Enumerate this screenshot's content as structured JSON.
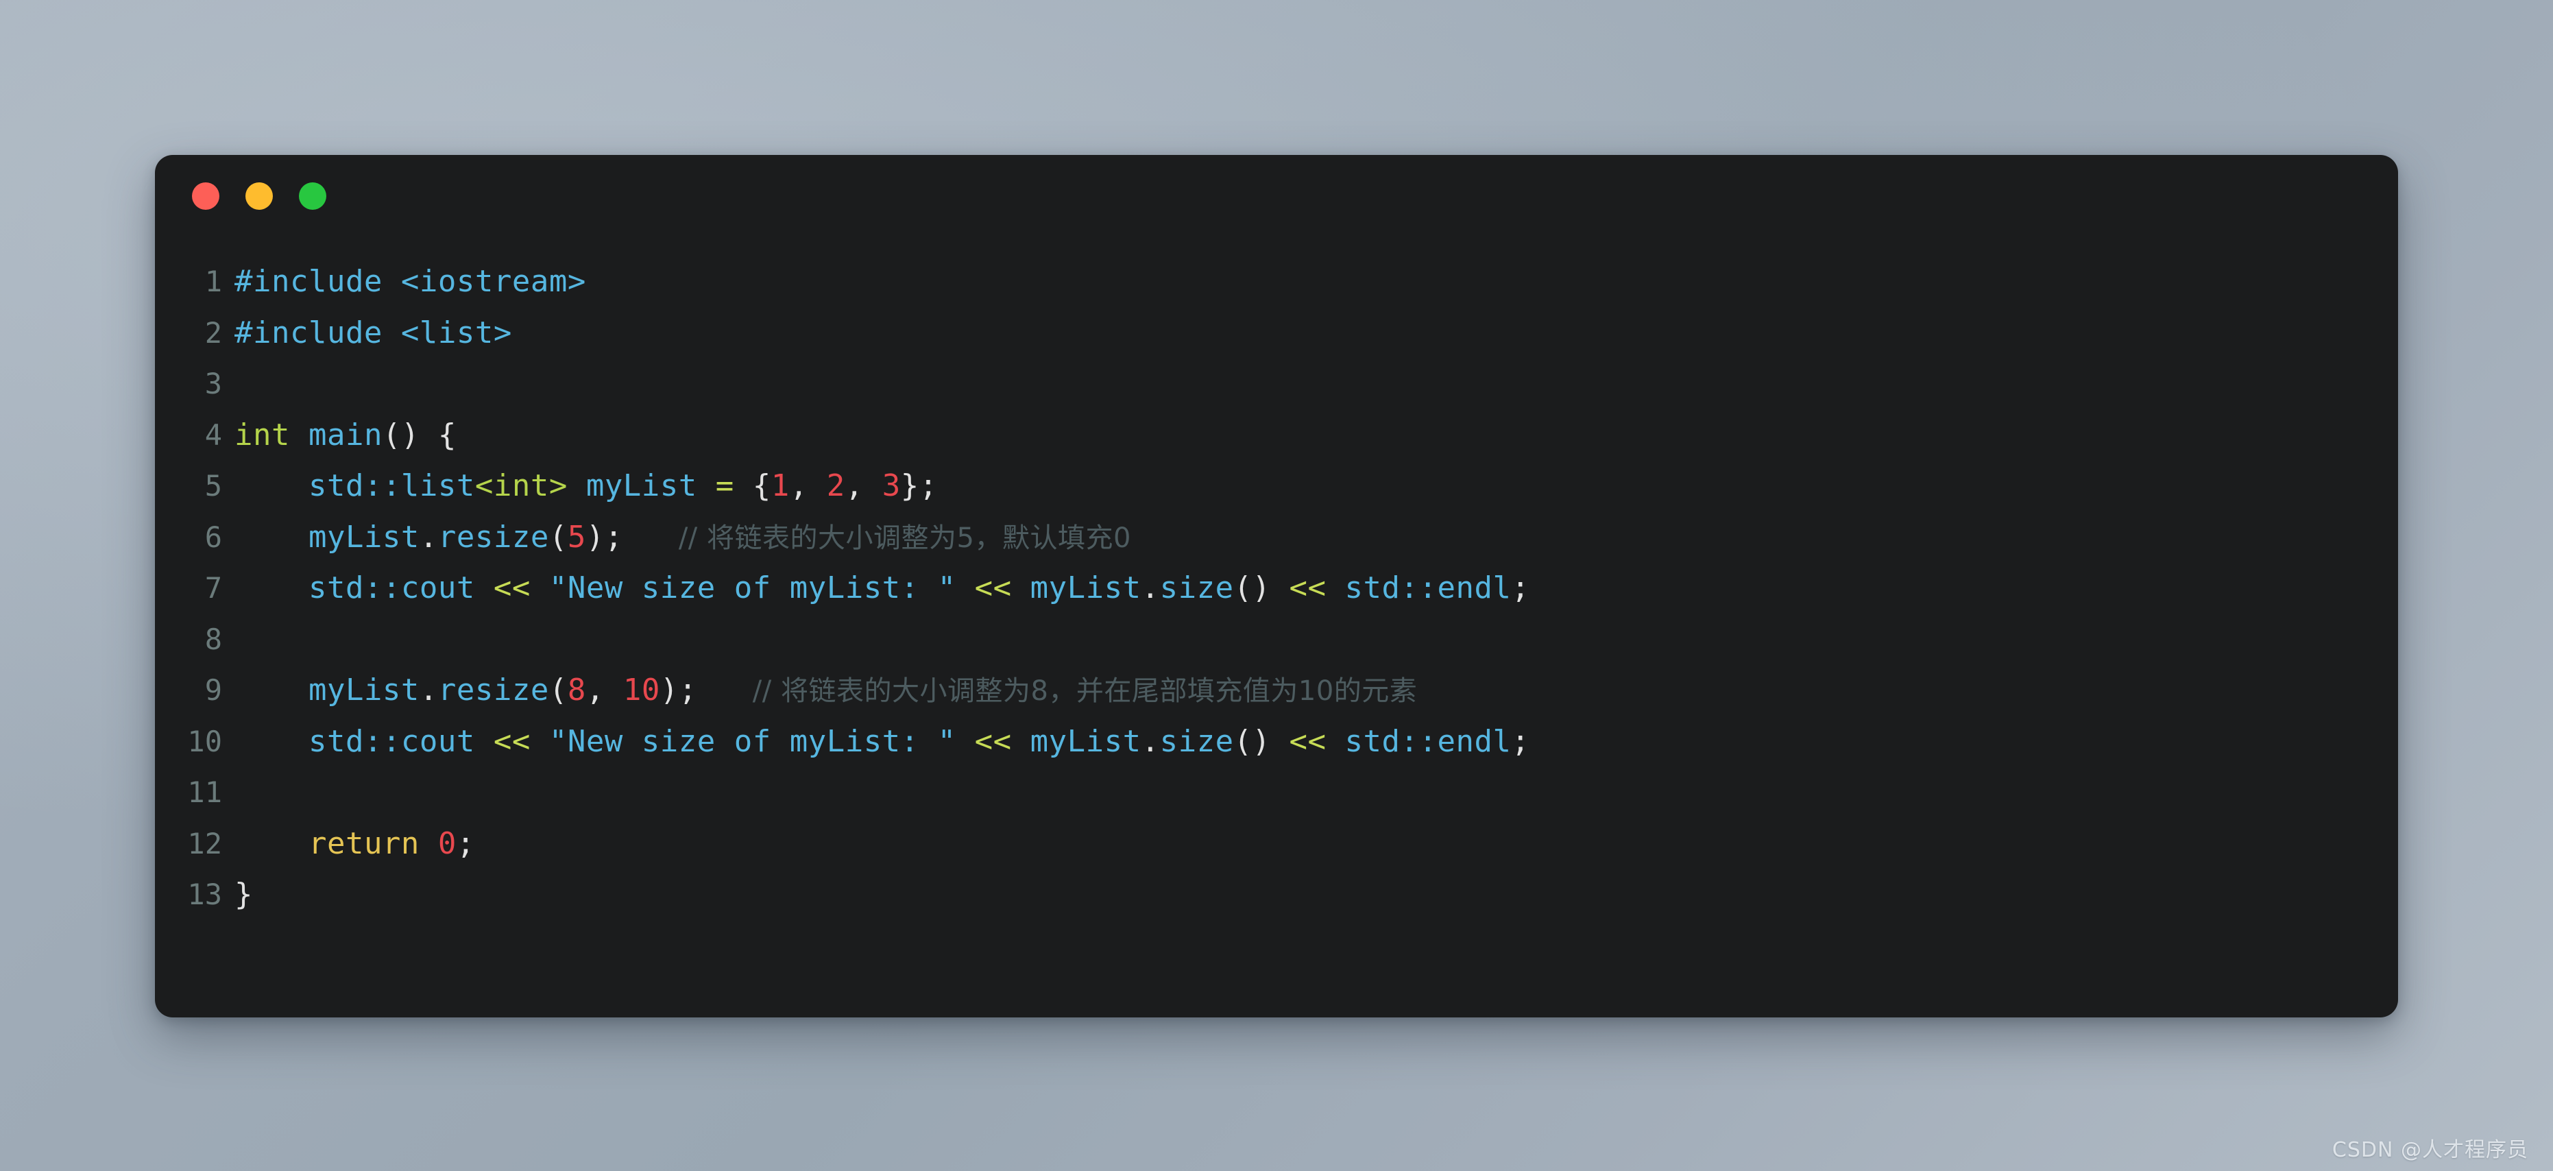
{
  "window": {
    "background_color": "#1b1c1d",
    "traffic_lights": [
      {
        "name": "close",
        "color": "#fd5f57"
      },
      {
        "name": "minimize",
        "color": "#febc2e"
      },
      {
        "name": "maximize",
        "color": "#28c740"
      }
    ]
  },
  "theme": {
    "page_background_start": "#a7b2bd",
    "page_background_end": "#b2bcc6",
    "line_number_color": "#6b7b7b",
    "identifier_color": "#56b6e0",
    "type_color": "#b5d44b",
    "operator_color": "#c7dc56",
    "number_color": "#e8484e",
    "keyword_color": "#e5c454",
    "punctuation_color": "#e2e2e2",
    "comment_color": "#4d5c60"
  },
  "watermark": {
    "text": "CSDN @人才程序员"
  },
  "code": {
    "language": "C++",
    "lines": [
      {
        "number": "1",
        "text": "#include <iostream>",
        "tokens": [
          {
            "t": "#include <iostream>",
            "c": "t-pre"
          }
        ]
      },
      {
        "number": "2",
        "text": "#include <list>",
        "tokens": [
          {
            "t": "#include <list>",
            "c": "t-pre"
          }
        ]
      },
      {
        "number": "3",
        "text": "",
        "tokens": []
      },
      {
        "number": "4",
        "text": "int main() {",
        "tokens": [
          {
            "t": "int",
            "c": "t-type"
          },
          {
            "t": " ",
            "c": "t-punc"
          },
          {
            "t": "main",
            "c": "t-ident"
          },
          {
            "t": "() {",
            "c": "t-punc"
          }
        ]
      },
      {
        "number": "5",
        "text": "    std::list<int> myList = {1, 2, 3};",
        "tokens": [
          {
            "t": "    std::list",
            "c": "t-ident"
          },
          {
            "t": "<int>",
            "c": "t-type"
          },
          {
            "t": " ",
            "c": "t-punc"
          },
          {
            "t": "myList",
            "c": "t-ident"
          },
          {
            "t": " ",
            "c": "t-punc"
          },
          {
            "t": "=",
            "c": "t-op"
          },
          {
            "t": " {",
            "c": "t-punc"
          },
          {
            "t": "1",
            "c": "t-num"
          },
          {
            "t": ", ",
            "c": "t-punc"
          },
          {
            "t": "2",
            "c": "t-num"
          },
          {
            "t": ", ",
            "c": "t-punc"
          },
          {
            "t": "3",
            "c": "t-num"
          },
          {
            "t": "};",
            "c": "t-punc"
          }
        ]
      },
      {
        "number": "6",
        "text": "    myList.resize(5);  // 将链表的大小调整为5，默认填充0",
        "tokens": [
          {
            "t": "    myList",
            "c": "t-ident"
          },
          {
            "t": ".",
            "c": "t-punc"
          },
          {
            "t": "resize",
            "c": "t-ident"
          },
          {
            "t": "(",
            "c": "t-punc"
          },
          {
            "t": "5",
            "c": "t-num"
          },
          {
            "t": ");",
            "c": "t-punc"
          },
          {
            "t": "   ",
            "c": "t-punc"
          },
          {
            "t": "// 将链表的大小调整为5，默认填充0",
            "c": "t-cmt"
          }
        ]
      },
      {
        "number": "7",
        "text": "    std::cout << \"New size of myList: \" << myList.size() << std::endl;",
        "tokens": [
          {
            "t": "    std::cout",
            "c": "t-ident"
          },
          {
            "t": " ",
            "c": "t-punc"
          },
          {
            "t": "<<",
            "c": "t-op"
          },
          {
            "t": " ",
            "c": "t-punc"
          },
          {
            "t": "\"New size of myList: \"",
            "c": "t-ident"
          },
          {
            "t": " ",
            "c": "t-punc"
          },
          {
            "t": "<<",
            "c": "t-op"
          },
          {
            "t": " ",
            "c": "t-punc"
          },
          {
            "t": "myList",
            "c": "t-ident"
          },
          {
            "t": ".",
            "c": "t-punc"
          },
          {
            "t": "size",
            "c": "t-ident"
          },
          {
            "t": "()",
            "c": "t-punc"
          },
          {
            "t": " ",
            "c": "t-punc"
          },
          {
            "t": "<<",
            "c": "t-op"
          },
          {
            "t": " ",
            "c": "t-punc"
          },
          {
            "t": "std::endl",
            "c": "t-ident"
          },
          {
            "t": ";",
            "c": "t-punc"
          }
        ]
      },
      {
        "number": "8",
        "text": "",
        "tokens": []
      },
      {
        "number": "9",
        "text": "    myList.resize(8, 10);  // 将链表的大小调整为8，并在尾部填充值为10的元素",
        "tokens": [
          {
            "t": "    myList",
            "c": "t-ident"
          },
          {
            "t": ".",
            "c": "t-punc"
          },
          {
            "t": "resize",
            "c": "t-ident"
          },
          {
            "t": "(",
            "c": "t-punc"
          },
          {
            "t": "8",
            "c": "t-num"
          },
          {
            "t": ", ",
            "c": "t-punc"
          },
          {
            "t": "10",
            "c": "t-num"
          },
          {
            "t": ");",
            "c": "t-punc"
          },
          {
            "t": "   ",
            "c": "t-punc"
          },
          {
            "t": "// 将链表的大小调整为8，并在尾部填充值为10的元素",
            "c": "t-cmt"
          }
        ]
      },
      {
        "number": "10",
        "text": "    std::cout << \"New size of myList: \" << myList.size() << std::endl;",
        "tokens": [
          {
            "t": "    std::cout",
            "c": "t-ident"
          },
          {
            "t": " ",
            "c": "t-punc"
          },
          {
            "t": "<<",
            "c": "t-op"
          },
          {
            "t": " ",
            "c": "t-punc"
          },
          {
            "t": "\"New size of myList: \"",
            "c": "t-ident"
          },
          {
            "t": " ",
            "c": "t-punc"
          },
          {
            "t": "<<",
            "c": "t-op"
          },
          {
            "t": " ",
            "c": "t-punc"
          },
          {
            "t": "myList",
            "c": "t-ident"
          },
          {
            "t": ".",
            "c": "t-punc"
          },
          {
            "t": "size",
            "c": "t-ident"
          },
          {
            "t": "()",
            "c": "t-punc"
          },
          {
            "t": " ",
            "c": "t-punc"
          },
          {
            "t": "<<",
            "c": "t-op"
          },
          {
            "t": " ",
            "c": "t-punc"
          },
          {
            "t": "std::endl",
            "c": "t-ident"
          },
          {
            "t": ";",
            "c": "t-punc"
          }
        ]
      },
      {
        "number": "11",
        "text": "",
        "tokens": []
      },
      {
        "number": "12",
        "text": "    return 0;",
        "tokens": [
          {
            "t": "    ",
            "c": "t-punc"
          },
          {
            "t": "return",
            "c": "t-kw"
          },
          {
            "t": " ",
            "c": "t-punc"
          },
          {
            "t": "0",
            "c": "t-num"
          },
          {
            "t": ";",
            "c": "t-punc"
          }
        ]
      },
      {
        "number": "13",
        "text": "}",
        "tokens": [
          {
            "t": "}",
            "c": "t-punc"
          }
        ]
      }
    ]
  }
}
